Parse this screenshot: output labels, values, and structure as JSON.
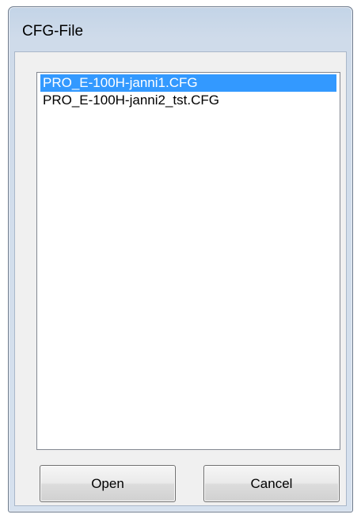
{
  "window": {
    "title": "CFG-File"
  },
  "file_list": {
    "items": [
      {
        "label": "PRO_E-100H-janni1.CFG",
        "selected": true
      },
      {
        "label": "PRO_E-100H-janni2_tst.CFG",
        "selected": false
      }
    ]
  },
  "buttons": {
    "open_label": "Open",
    "cancel_label": "Cancel"
  },
  "colors": {
    "selection": "#3399ff",
    "frame": "#cfdbea",
    "client": "#f0f0f0"
  }
}
